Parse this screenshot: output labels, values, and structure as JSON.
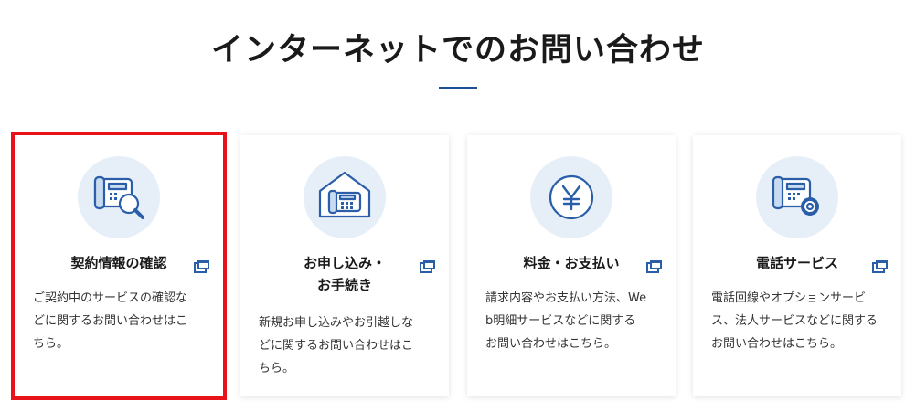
{
  "page": {
    "title": "インターネットでのお問い合わせ"
  },
  "colors": {
    "accent": "#1f4f96",
    "icon_bg": "#e6eff8",
    "selection": "#e8121b"
  },
  "cards": [
    {
      "icon": "phone-search-icon",
      "title_line1": "契約情報の確認",
      "title_line2": "",
      "description": "ご契約中のサービスの確認な\nどに関するお問い合わせはこ\nちら。",
      "selected": true
    },
    {
      "icon": "house-phone-icon",
      "title_line1": "お申し込み・",
      "title_line2": "お手続き",
      "description": "新規お申し込みやお引越しな\nどに関するお問い合わせはこ\nちら。",
      "selected": false
    },
    {
      "icon": "yen-coin-icon",
      "title_line1": "料金・お支払い",
      "title_line2": "",
      "description": "請求内容やお支払い方法、We\nb明細サービスなどに関する\nお問い合わせはこちら。",
      "selected": false
    },
    {
      "icon": "phone-gear-icon",
      "title_line1": "電話サービス",
      "title_line2": "",
      "description": "電話回線やオプションサービ\nス、法人サービスなどに関する\nお問い合わせはこちら。",
      "selected": false
    }
  ]
}
